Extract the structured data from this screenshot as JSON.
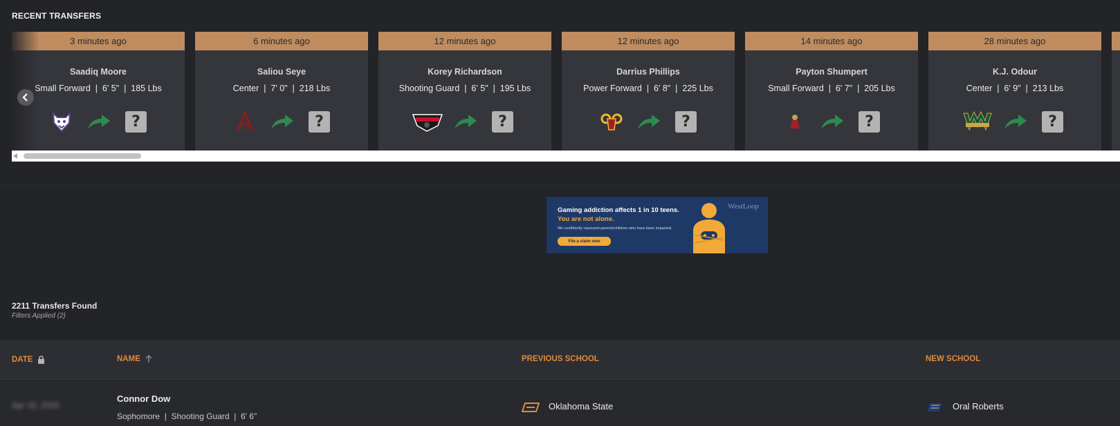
{
  "section": {
    "title": "RECENT TRANSFERS"
  },
  "carousel": {
    "cards": [
      {
        "time": "3 minutes ago",
        "name": "Saadiq Moore",
        "meta": "Small Forward  |  6' 5\"  |  185 Lbs",
        "from_logo": "wildcat-logo-icon"
      },
      {
        "time": "6 minutes ago",
        "name": "Saliou Seye",
        "meta": "Center  |  7' 0\"  |  218 Lbs",
        "from_logo": "alabama-am-logo-icon"
      },
      {
        "time": "12 minutes ago",
        "name": "Korey Richardson",
        "meta": "Shooting Guard  |  6' 5\"  |  195 Lbs",
        "from_logo": "panthers-logo-icon"
      },
      {
        "time": "12 minutes ago",
        "name": "Darrius Phillips",
        "meta": "Power Forward  |  6' 8\"  |  225 Lbs",
        "from_logo": "ram-logo-icon"
      },
      {
        "time": "14 minutes ago",
        "name": "Payton Shumpert",
        "meta": "Small Forward  |  6' 7\"  |  205 Lbs",
        "from_logo": "mascot-logo-icon"
      },
      {
        "time": "28 minutes ago",
        "name": "K.J. Odour",
        "meta": "Center  |  6' 9\"  |  213 Lbs",
        "from_logo": "wayne-state-logo-icon"
      }
    ],
    "unknown_glyph": "?"
  },
  "ad": {
    "headline": "Gaming addiction affects 1 in 10 teens.",
    "subheadline": "You are not alone.",
    "body": "We confidently represent parents/children who have been impacted.",
    "cta": "File a claim now",
    "brand": "WestLoop",
    "accent": "#f1a93a",
    "background": "#1f3966"
  },
  "results": {
    "count": "2211 Transfers Found",
    "filters": "Filters Applied (2)"
  },
  "table": {
    "columns": {
      "date": "DATE",
      "name": "NAME",
      "previous": "PREVIOUS SCHOOL",
      "new": "NEW SCHOOL"
    },
    "rows": [
      {
        "date": "Apr 16, 2025",
        "name": "Connor Dow",
        "meta": "Sophomore  |  Shooting Guard  |  6' 6\"",
        "previous_school": "Oklahoma State",
        "previous_logo": "osu-logo-icon",
        "new_school": "Oral Roberts",
        "new_logo": "oru-logo-icon"
      }
    ]
  },
  "colors": {
    "background": "#232428",
    "card": "#35363b",
    "card_header": "#bf8c60",
    "accent_orange": "#e08a3c",
    "arrow_green": "#2e8b4f"
  }
}
